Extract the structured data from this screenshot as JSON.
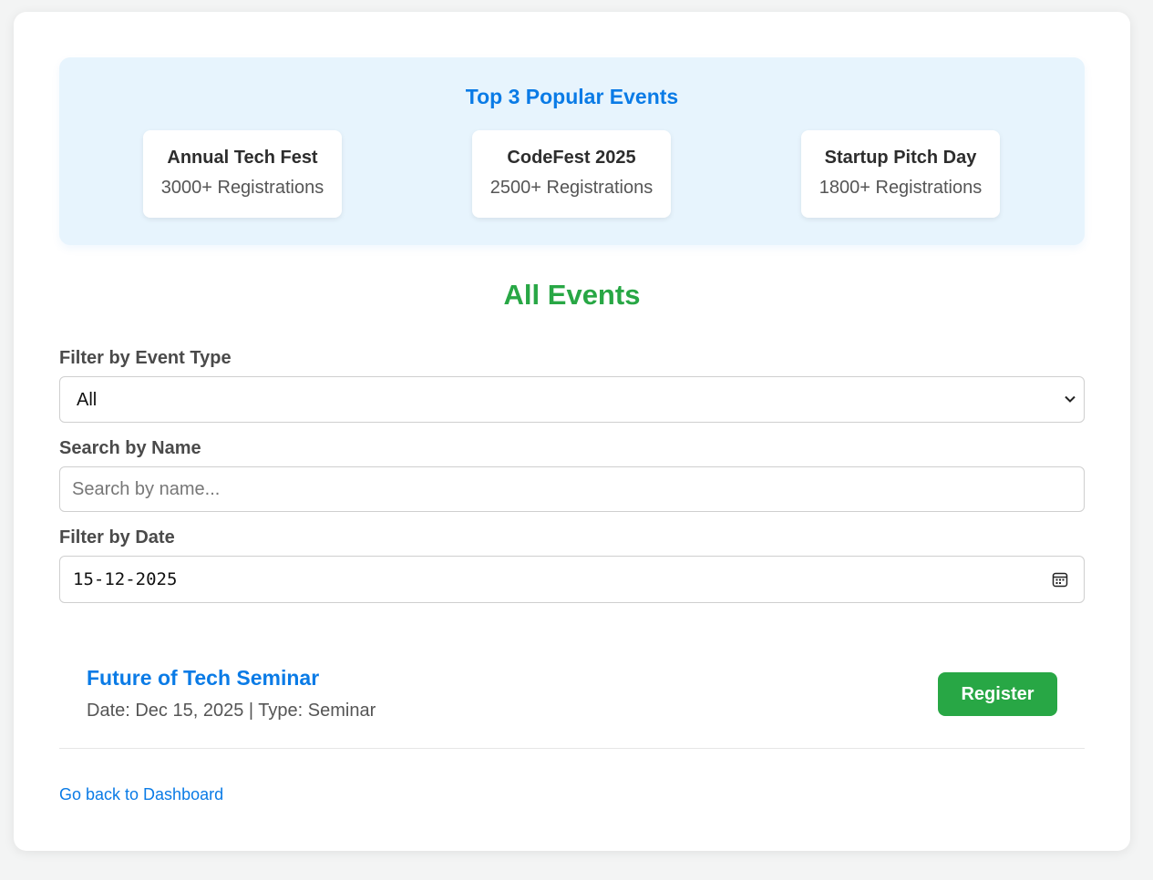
{
  "popular": {
    "title": "Top 3 Popular Events",
    "items": [
      {
        "name": "Annual Tech Fest",
        "registrations": "3000+ Registrations"
      },
      {
        "name": "CodeFest 2025",
        "registrations": "2500+ Registrations"
      },
      {
        "name": "Startup Pitch Day",
        "registrations": "1800+ Registrations"
      }
    ]
  },
  "all_events": {
    "title": "All Events"
  },
  "filters": {
    "type_label": "Filter by Event Type",
    "type_value": "All",
    "search_label": "Search by Name",
    "search_placeholder": "Search by name...",
    "date_label": "Filter by Date",
    "date_value": "15-12-2025"
  },
  "events": [
    {
      "title": "Future of Tech Seminar",
      "meta": "Date: Dec 15, 2025 | Type: Seminar",
      "action": "Register"
    }
  ],
  "footer": {
    "back_link": "Go back to Dashboard"
  },
  "colors": {
    "accent_blue": "#0a7be6",
    "accent_green": "#28a745",
    "popular_bg": "#e7f4fd"
  },
  "icons": {
    "select": "chevron-down-icon",
    "date": "calendar-icon"
  }
}
